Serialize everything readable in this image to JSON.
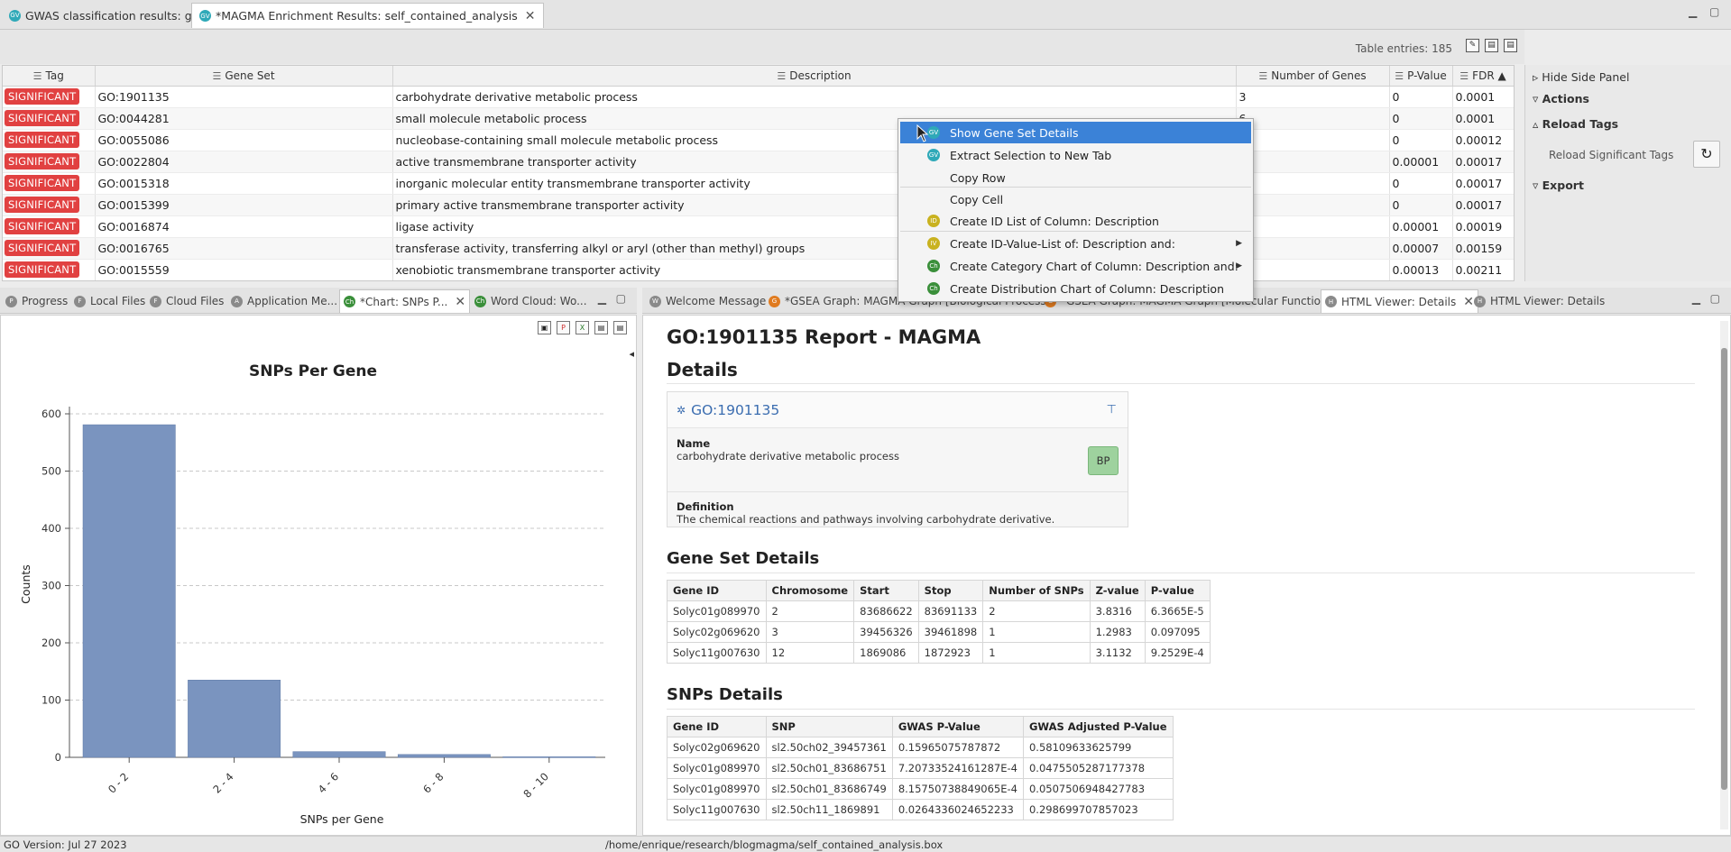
{
  "top_tabs": [
    {
      "label": "GWAS classification results: glm2",
      "icon": "GV",
      "active": false
    },
    {
      "label": "*MAGMA Enrichment Results: self_contained_analysis",
      "icon": "GV",
      "active": true
    }
  ],
  "table": {
    "entries_label": "Table entries: 185",
    "columns": [
      "Tag",
      "Gene Set",
      "Description",
      "Number of Genes",
      "P-Value",
      "FDR ▲"
    ],
    "rows": [
      {
        "tag": "SIGNIFICANT",
        "gene_set": "GO:1901135",
        "description": "carbohydrate derivative metabolic process",
        "num_genes": "3",
        "p_value": "0",
        "fdr": "0.0001"
      },
      {
        "tag": "SIGNIFICANT",
        "gene_set": "GO:0044281",
        "description": "small molecule metabolic process",
        "num_genes": "6",
        "p_value": "0",
        "fdr": "0.0001"
      },
      {
        "tag": "SIGNIFICANT",
        "gene_set": "GO:0055086",
        "description": "nucleobase-containing small molecule metabolic process",
        "num_genes": "",
        "p_value": "0",
        "fdr": "0.00012"
      },
      {
        "tag": "SIGNIFICANT",
        "gene_set": "GO:0022804",
        "description": "active transmembrane transporter activity",
        "num_genes": "",
        "p_value": "0.00001",
        "fdr": "0.00017"
      },
      {
        "tag": "SIGNIFICANT",
        "gene_set": "GO:0015318",
        "description": "inorganic molecular entity transmembrane transporter activity",
        "num_genes": "",
        "p_value": "0",
        "fdr": "0.00017"
      },
      {
        "tag": "SIGNIFICANT",
        "gene_set": "GO:0015399",
        "description": "primary active transmembrane transporter activity",
        "num_genes": "",
        "p_value": "0",
        "fdr": "0.00017"
      },
      {
        "tag": "SIGNIFICANT",
        "gene_set": "GO:0016874",
        "description": "ligase activity",
        "num_genes": "",
        "p_value": "0.00001",
        "fdr": "0.00019"
      },
      {
        "tag": "SIGNIFICANT",
        "gene_set": "GO:0016765",
        "description": "transferase activity, transferring alkyl or aryl (other than methyl) groups",
        "num_genes": "",
        "p_value": "0.00007",
        "fdr": "0.00159"
      },
      {
        "tag": "SIGNIFICANT",
        "gene_set": "GO:0015559",
        "description": "xenobiotic transmembrane transporter activity",
        "num_genes": "",
        "p_value": "0.00013",
        "fdr": "0.00211"
      }
    ]
  },
  "side_panel": {
    "hide_label": "Hide Side Panel",
    "actions_label": "Actions",
    "reload_tags_label": "Reload Tags",
    "reload_significant_label": "Reload Significant Tags",
    "export_label": "Export"
  },
  "context_menu": {
    "items": [
      {
        "label": "Show Gene Set Details",
        "icon": "GV",
        "selected": true,
        "submenu": false
      },
      {
        "label": "Extract Selection to New Tab",
        "icon": "GV",
        "selected": false,
        "submenu": false
      },
      {
        "label": "Copy Row",
        "icon": "",
        "selected": false,
        "submenu": false
      },
      {
        "label": "Copy Cell",
        "icon": "",
        "selected": false,
        "submenu": false
      },
      {
        "label": "Create ID List of Column: Description",
        "icon": "ID",
        "selected": false,
        "submenu": false
      },
      {
        "label": "Create ID-Value-List of: Description and:",
        "icon": "IV",
        "selected": false,
        "submenu": true
      },
      {
        "label": "Create Category Chart of Column: Description and:",
        "icon": "Ch",
        "selected": false,
        "submenu": true
      },
      {
        "label": "Create Distribution Chart of Column: Description",
        "icon": "Ch",
        "selected": false,
        "submenu": false
      }
    ]
  },
  "bottom_left_tabs": [
    {
      "label": "Progress",
      "icon": "P"
    },
    {
      "label": "Local Files",
      "icon": "F"
    },
    {
      "label": "Cloud Files",
      "icon": "F"
    },
    {
      "label": "Application Me...",
      "icon": "A"
    },
    {
      "label": "*Chart: SNPs P...",
      "icon": "Ch",
      "active": true
    },
    {
      "label": "Word Cloud: Wo...",
      "icon": "Ch"
    }
  ],
  "bottom_right_tabs": [
    {
      "label": "Welcome Message",
      "icon": "W"
    },
    {
      "label": "*GSEA Graph: MAGMA Graph [Biological Process]",
      "icon": "G"
    },
    {
      "label": "*GSEA Graph: MAGMA Graph [Molecular Function]",
      "icon": "G"
    },
    {
      "label": "HTML Viewer: Details",
      "icon": "H",
      "active": true
    },
    {
      "label": "HTML Viewer: Details",
      "icon": "H"
    }
  ],
  "chart_data": {
    "type": "bar",
    "title": "SNPs Per Gene",
    "xlabel": "SNPs per Gene",
    "ylabel": "Counts",
    "categories": [
      "0 - 2",
      "2 - 4",
      "4 - 6",
      "6 - 8",
      "8 - 10"
    ],
    "values": [
      581,
      135,
      10,
      5,
      1
    ],
    "ylim": [
      0,
      600
    ],
    "yticks": [
      0,
      100,
      200,
      300,
      400,
      500,
      600
    ],
    "grid": "horizontal-dashed",
    "bar_color": "#7a94bf"
  },
  "report": {
    "title": "GO:1901135 Report - MAGMA",
    "details_heading": "Details",
    "go_id": "GO:1901135",
    "name_label": "Name",
    "name_value": "carbohydrate derivative metabolic process",
    "namespace_badge": "BP",
    "definition_label": "Definition",
    "definition_value": "The chemical reactions and pathways involving carbohydrate derivative.",
    "gene_set_heading": "Gene Set Details",
    "gene_set_columns": [
      "Gene ID",
      "Chromosome",
      "Start",
      "Stop",
      "Number of SNPs",
      "Z-value",
      "P-value"
    ],
    "gene_set_rows": [
      [
        "Solyc01g089970",
        "2",
        "83686622",
        "83691133",
        "2",
        "3.8316",
        "6.3665E-5"
      ],
      [
        "Solyc02g069620",
        "3",
        "39456326",
        "39461898",
        "1",
        "1.2983",
        "0.097095"
      ],
      [
        "Solyc11g007630",
        "12",
        "1869086",
        "1872923",
        "1",
        "3.1132",
        "9.2529E-4"
      ]
    ],
    "snps_heading": "SNPs Details",
    "snps_columns": [
      "Gene ID",
      "SNP",
      "GWAS P-Value",
      "GWAS Adjusted P-Value"
    ],
    "snps_rows": [
      [
        "Solyc02g069620",
        "sl2.50ch02_39457361",
        "0.15965075787872",
        "0.58109633625799"
      ],
      [
        "Solyc01g089970",
        "sl2.50ch01_83686751",
        "7.20733524161287E-4",
        "0.0475505287177378"
      ],
      [
        "Solyc01g089970",
        "sl2.50ch01_83686749",
        "8.15750738849065E-4",
        "0.0507506948427783"
      ],
      [
        "Solyc11g007630",
        "sl2.50ch11_1869891",
        "0.0264336024652233",
        "0.298699707857023"
      ]
    ]
  },
  "status": {
    "version": "GO Version: Jul 27 2023",
    "path": "/home/enrique/research/blogmagma/self_contained_analysis.box"
  }
}
